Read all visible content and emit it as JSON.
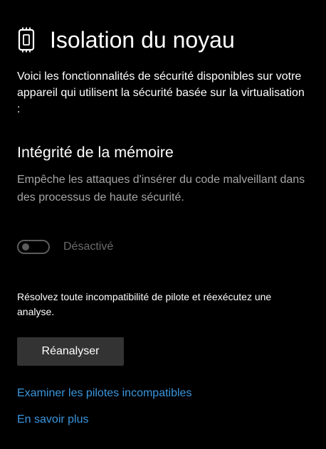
{
  "header": {
    "icon": "core-isolation-chip-icon",
    "title": "Isolation du noyau"
  },
  "intro": {
    "text": "Voici les fonctionnalités de sécurité disponibles sur votre appareil qui utilisent la sécurité basée sur la virtualisation :"
  },
  "memory_integrity": {
    "title": "Intégrité de la mémoire",
    "description": "Empêche les attaques d'insérer du code malveillant dans des processus de haute sécurité.",
    "toggle": {
      "state": "off",
      "label": "Désactivé"
    }
  },
  "driver_note": {
    "text": "Résolvez toute incompatibilité de pilote et réexécutez une analyse."
  },
  "actions": {
    "rescan_label": "Réanalyser",
    "review_drivers_link": "Examiner les pilotes incompatibles",
    "learn_more_link": "En savoir plus"
  },
  "colors": {
    "background": "#000000",
    "text": "#ffffff",
    "muted_text": "#a6a6a6",
    "disabled": "#5c5c5c",
    "link": "#3a96dd",
    "button": "#333333"
  }
}
